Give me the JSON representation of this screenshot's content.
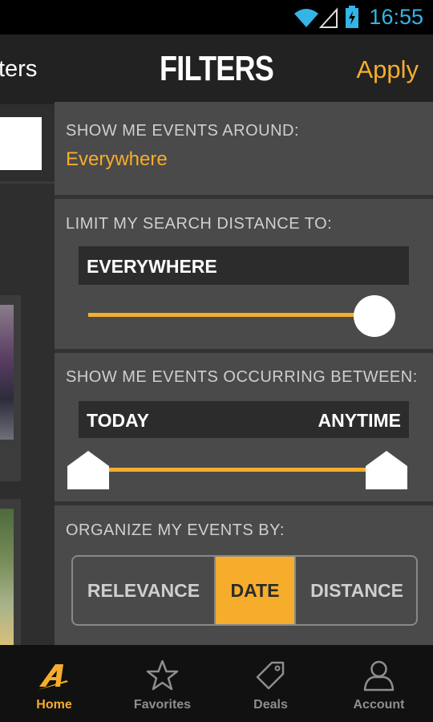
{
  "status_bar": {
    "time": "16:55"
  },
  "header": {
    "back_label": "ters",
    "title": "FILTERS",
    "apply_label": "Apply"
  },
  "filters": {
    "around": {
      "label": "SHOW ME EVENTS AROUND:",
      "value": "Everywhere"
    },
    "distance": {
      "label": "LIMIT MY SEARCH DISTANCE TO:",
      "value": "EVERYWHERE",
      "slider_level": 1.0
    },
    "dates": {
      "label": "SHOW ME EVENTS OCCURRING BETWEEN:",
      "start": "TODAY",
      "end": "ANYTIME",
      "range": [
        0.0,
        1.0
      ]
    },
    "organize": {
      "label": "ORGANIZE MY EVENTS BY:",
      "options": [
        "RELEVANCE",
        "DATE",
        "DISTANCE"
      ],
      "selected": "DATE"
    }
  },
  "tabs": [
    {
      "label": "Home",
      "icon": "home-a-icon",
      "active": true
    },
    {
      "label": "Favorites",
      "icon": "star-icon",
      "active": false
    },
    {
      "label": "Deals",
      "icon": "tag-icon",
      "active": false
    },
    {
      "label": "Account",
      "icon": "user-icon",
      "active": false
    }
  ],
  "colors": {
    "accent": "#f6ad2b",
    "status_blue": "#33b5e5"
  }
}
